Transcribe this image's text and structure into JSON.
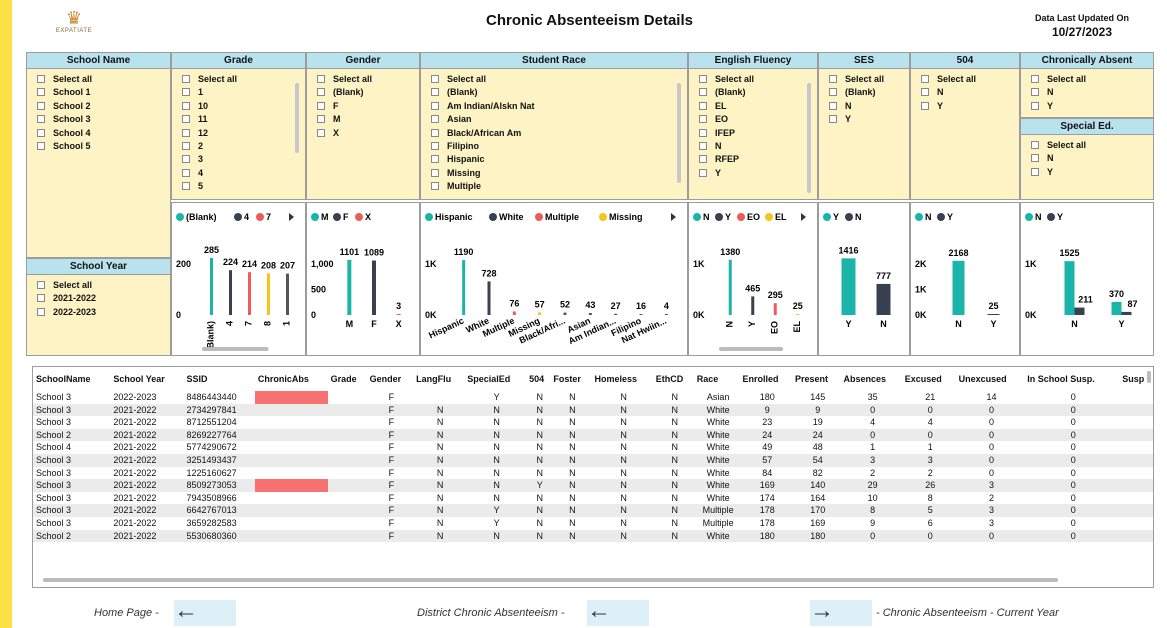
{
  "header": {
    "title": "Chronic Absenteeism Details",
    "logo_text": "EXPATIATE",
    "updated_label": "Data Last Updated On",
    "updated_date": "10/27/2023"
  },
  "slicers": {
    "school_name": {
      "title": "School Name",
      "items": [
        "Select all",
        "School 1",
        "School 2",
        "School 3",
        "School 4",
        "School 5"
      ]
    },
    "grade": {
      "title": "Grade",
      "items": [
        "Select all",
        "1",
        "10",
        "11",
        "12",
        "2",
        "3",
        "4",
        "5"
      ]
    },
    "gender": {
      "title": "Gender",
      "items": [
        "Select all",
        "(Blank)",
        "F",
        "M",
        "X"
      ]
    },
    "race": {
      "title": "Student Race",
      "items": [
        "Select all",
        "(Blank)",
        "Am Indian/Alskn Nat",
        "Asian",
        "Black/African Am",
        "Filipino",
        "Hispanic",
        "Missing",
        "Multiple"
      ]
    },
    "english": {
      "title": "English Fluency",
      "items": [
        "Select all",
        "(Blank)",
        "EL",
        "EO",
        "IFEP",
        "N",
        "RFEP",
        "Y"
      ]
    },
    "ses": {
      "title": "SES",
      "items": [
        "Select all",
        "(Blank)",
        "N",
        "Y"
      ]
    },
    "s504": {
      "title": "504",
      "items": [
        "Select all",
        "N",
        "Y"
      ]
    },
    "chronic": {
      "title": "Chronically Absent",
      "items": [
        "Select all",
        "N",
        "Y"
      ]
    },
    "special": {
      "title": "Special Ed.",
      "items": [
        "Select all",
        "N",
        "Y"
      ]
    },
    "year": {
      "title": "School Year",
      "items": [
        "Select all",
        "2021-2022",
        "2022-2023"
      ]
    }
  },
  "chart_data": [
    {
      "type": "bar",
      "id": "grade",
      "legend": [
        {
          "name": "(Blank)",
          "color": "#1ab5a8"
        },
        {
          "name": "4",
          "color": "#374151"
        },
        {
          "name": "7",
          "color": "#f05a5a"
        }
      ],
      "categories": [
        "(Blank)",
        "4",
        "7",
        "8",
        "1"
      ],
      "values": [
        285,
        224,
        214,
        208,
        207
      ],
      "colors": [
        "#1ab5a8",
        "#374151",
        "#f05a5a",
        "#f5c518",
        "#555555"
      ],
      "yticks": [
        "200",
        "0"
      ],
      "ymax": 300,
      "style": "lollipop"
    },
    {
      "type": "bar",
      "id": "gender",
      "legend": [
        {
          "name": "M",
          "color": "#1ab5a8"
        },
        {
          "name": "F",
          "color": "#374151"
        },
        {
          "name": "X",
          "color": "#f05a5a"
        }
      ],
      "categories": [
        "M",
        "F",
        "X"
      ],
      "values": [
        1101,
        1089,
        3
      ],
      "colors": [
        "#1ab5a8",
        "#374151",
        "#f05a5a"
      ],
      "yticks": [
        "1,000",
        "500",
        "0"
      ],
      "ymax": 1200,
      "style": "thin"
    },
    {
      "type": "bar",
      "id": "race",
      "legend": [
        {
          "name": "Hispanic",
          "color": "#1ab5a8"
        },
        {
          "name": "White",
          "color": "#374151"
        },
        {
          "name": "Multiple",
          "color": "#f05a5a"
        },
        {
          "name": "Missing",
          "color": "#f5c518"
        }
      ],
      "categories": [
        "Hispanic",
        "White",
        "Multiple",
        "Missing",
        "Black/Afri...",
        "Asian",
        "Am Indian...",
        "Filipino",
        "Nat Hwiin..."
      ],
      "values": [
        1190,
        728,
        76,
        57,
        52,
        43,
        27,
        16,
        4
      ],
      "colors": [
        "#1ab5a8",
        "#374151",
        "#f05a5a",
        "#f5c518",
        "#555555",
        "#555555",
        "#555555",
        "#555555",
        "#555555"
      ],
      "yticks": [
        "1K",
        "0K"
      ],
      "ymax": 1300,
      "style": "lollipop"
    },
    {
      "type": "bar",
      "id": "english",
      "legend": [
        {
          "name": "N",
          "color": "#1ab5a8"
        },
        {
          "name": "Y",
          "color": "#374151"
        },
        {
          "name": "EO",
          "color": "#f05a5a"
        },
        {
          "name": "EL",
          "color": "#f5c518"
        }
      ],
      "categories": [
        "N",
        "Y",
        "EO",
        "EL"
      ],
      "values": [
        1380,
        465,
        295,
        25
      ],
      "colors": [
        "#1ab5a8",
        "#374151",
        "#f05a5a",
        "#f5c518"
      ],
      "yticks": [
        "1K",
        "0K"
      ],
      "ymax": 1500,
      "style": "lollipop"
    },
    {
      "type": "bar",
      "id": "ses",
      "legend": [
        {
          "name": "Y",
          "color": "#1ab5a8"
        },
        {
          "name": "N",
          "color": "#374151"
        }
      ],
      "categories": [
        "Y",
        "N"
      ],
      "values": [
        1416,
        777
      ],
      "colors": [
        "#1ab5a8",
        "#374151"
      ],
      "yticks": [],
      "ymax": 1500,
      "style": "wide"
    },
    {
      "type": "bar",
      "id": "s504",
      "legend": [
        {
          "name": "N",
          "color": "#1ab5a8"
        },
        {
          "name": "Y",
          "color": "#374151"
        }
      ],
      "categories": [
        "N",
        "Y"
      ],
      "values": [
        2168,
        25
      ],
      "colors": [
        "#1ab5a8",
        "#374151"
      ],
      "yticks": [
        "2K",
        "1K",
        "0K"
      ],
      "ymax": 2400,
      "style": "medium"
    },
    {
      "type": "bar",
      "id": "special",
      "legend": [
        {
          "name": "N",
          "color": "#1ab5a8"
        },
        {
          "name": "Y",
          "color": "#374151"
        }
      ],
      "categories": [
        "N",
        "Y"
      ],
      "series": [
        {
          "name": "N",
          "values": [
            1525,
            370
          ]
        },
        {
          "name": "Y",
          "values": [
            211,
            87
          ]
        }
      ],
      "colors": [
        "#1ab5a8",
        "#374151"
      ],
      "yticks": [
        "1K",
        "0K"
      ],
      "ymax": 1700,
      "style": "grouped"
    }
  ],
  "table": {
    "columns": [
      "SchoolName",
      "School Year",
      "SSID",
      "ChronicAbs",
      "Grade",
      "Gender",
      "LangFlu",
      "SpecialEd",
      "504",
      "Foster",
      "Homeless",
      "EthCD",
      "Race",
      "Enrolled",
      "Present",
      "Absences",
      "Excused",
      "Unexcused",
      "In School Susp.",
      "Susp"
    ],
    "rows": [
      [
        "School 3",
        "2022-2023",
        "8486443440",
        "hl",
        "",
        "F",
        "",
        "Y",
        "N",
        "N",
        "N",
        "N",
        "Asian",
        "180",
        "145",
        "35",
        "21",
        "14",
        "0"
      ],
      [
        "School 3",
        "2021-2022",
        "2734297841",
        "",
        "",
        "F",
        "N",
        "N",
        "N",
        "N",
        "N",
        "N",
        "White",
        "9",
        "9",
        "0",
        "0",
        "0",
        "0"
      ],
      [
        "School 3",
        "2021-2022",
        "8712551204",
        "",
        "",
        "F",
        "N",
        "N",
        "N",
        "N",
        "N",
        "N",
        "White",
        "23",
        "19",
        "4",
        "4",
        "0",
        "0"
      ],
      [
        "School 2",
        "2021-2022",
        "8269227764",
        "",
        "",
        "F",
        "N",
        "N",
        "N",
        "N",
        "N",
        "N",
        "White",
        "24",
        "24",
        "0",
        "0",
        "0",
        "0"
      ],
      [
        "School 4",
        "2021-2022",
        "5774290672",
        "",
        "",
        "F",
        "N",
        "N",
        "N",
        "N",
        "N",
        "N",
        "White",
        "49",
        "48",
        "1",
        "1",
        "0",
        "0"
      ],
      [
        "School 3",
        "2021-2022",
        "3251493437",
        "",
        "",
        "F",
        "N",
        "N",
        "N",
        "N",
        "N",
        "N",
        "White",
        "57",
        "54",
        "3",
        "3",
        "0",
        "0"
      ],
      [
        "School 3",
        "2021-2022",
        "1225160627",
        "",
        "",
        "F",
        "N",
        "N",
        "N",
        "N",
        "N",
        "N",
        "White",
        "84",
        "82",
        "2",
        "2",
        "0",
        "0"
      ],
      [
        "School 3",
        "2021-2022",
        "8509273053",
        "hl",
        "",
        "F",
        "N",
        "N",
        "Y",
        "N",
        "N",
        "N",
        "White",
        "169",
        "140",
        "29",
        "26",
        "3",
        "0"
      ],
      [
        "School 3",
        "2021-2022",
        "7943508966",
        "",
        "",
        "F",
        "N",
        "N",
        "N",
        "N",
        "N",
        "N",
        "White",
        "174",
        "164",
        "10",
        "8",
        "2",
        "0"
      ],
      [
        "School 3",
        "2021-2022",
        "6642767013",
        "",
        "",
        "F",
        "N",
        "Y",
        "N",
        "N",
        "N",
        "N",
        "Multiple",
        "178",
        "170",
        "8",
        "5",
        "3",
        "0"
      ],
      [
        "School 3",
        "2021-2022",
        "3659282583",
        "",
        "",
        "F",
        "N",
        "Y",
        "N",
        "N",
        "N",
        "N",
        "Multiple",
        "178",
        "169",
        "9",
        "6",
        "3",
        "0"
      ],
      [
        "School 2",
        "2021-2022",
        "5530680360",
        "",
        "",
        "F",
        "N",
        "N",
        "N",
        "N",
        "N",
        "N",
        "White",
        "180",
        "180",
        "0",
        "0",
        "0",
        "0"
      ]
    ]
  },
  "nav": {
    "home": "Home Page -",
    "district": "District Chronic Absenteeism -",
    "current": "- Chronic Absenteeism - Current Year",
    "arrow_left": "←",
    "arrow_right": "→"
  }
}
